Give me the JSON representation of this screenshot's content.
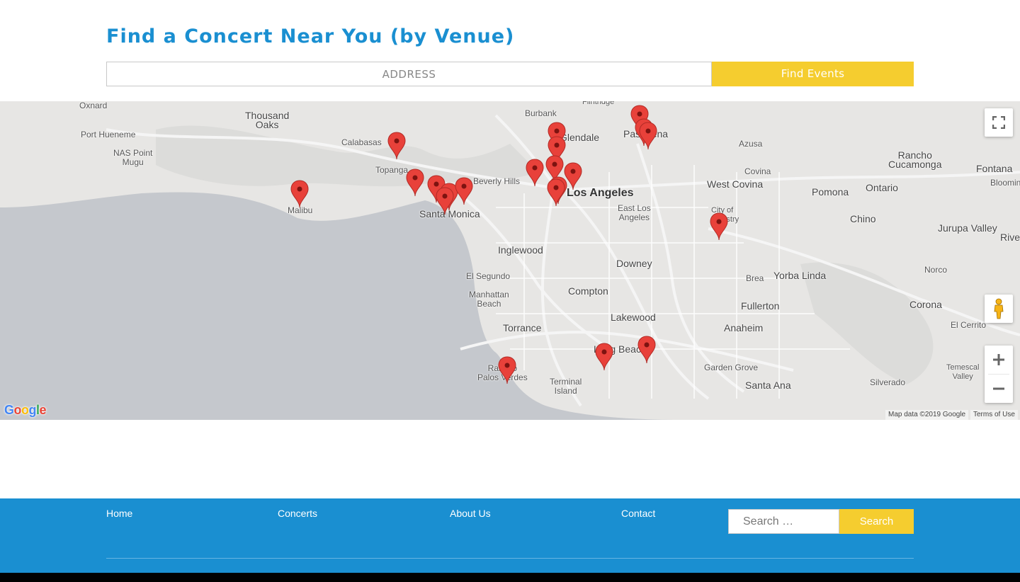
{
  "header": {
    "title": "Find a Concert Near You (by Venue)",
    "address_placeholder": "ADDRESS",
    "find_label": "Find Events"
  },
  "map": {
    "labels": {
      "oxnard": "Oxnard",
      "thousand_oaks": "Thousand\nOaks",
      "port_hueneme": "Port Hueneme",
      "nas_point_mugu": "NAS Point\nMugu",
      "calabasas": "Calabasas",
      "topanga": "Topanga",
      "malibu": "Malibu",
      "santa_monica": "Santa Monica",
      "beverly_hills": "Beverly Hills",
      "burbank": "Burbank",
      "glendale": "Glendale",
      "flintridge": "Flintridge",
      "pasadena": "Pasadena",
      "los_angeles": "Los Angeles",
      "east_los_angeles": "East Los\nAngeles",
      "inglewood": "Inglewood",
      "el_segundo": "El Segundo",
      "manhattan_beach": "Manhattan\nBeach",
      "torrance": "Torrance",
      "rancho_palos_verdes": "Rancho\nPalos Verdes",
      "compton": "Compton",
      "downey": "Downey",
      "lakewood": "Lakewood",
      "long_beach": "Long Beach",
      "terminal_island": "Terminal\nIsland",
      "azusa": "Azusa",
      "covina": "Covina",
      "west_covina": "West Covina",
      "city_of_industry": "City of\nIndustry",
      "pomona": "Pomona",
      "ontario": "Ontario",
      "rancho_cucamonga": "Rancho\nCucamonga",
      "fontana": "Fontana",
      "bloomington": "Bloomin",
      "chino": "Chino",
      "jurupa_valley": "Jurupa Valley",
      "riverside": "Rive",
      "norco": "Norco",
      "brea": "Brea",
      "yorba_linda": "Yorba Linda",
      "fullerton": "Fullerton",
      "anaheim": "Anaheim",
      "corona": "Corona",
      "el_cerrito": "El Cerrito",
      "garden_grove": "Garden Grove",
      "santa_ana": "Santa Ana",
      "silverado": "Silverado",
      "temescal_valley": "Temescal\nValley"
    },
    "google_logo": "Google",
    "map_data_text": "Map data ©2019 Google",
    "terms_text": "Terms of Use",
    "marker_color": "#e8413a"
  },
  "footer": {
    "nav": {
      "home": "Home",
      "concerts": "Concerts",
      "about": "About Us",
      "contact": "Contact"
    },
    "search_placeholder": "Search …",
    "search_label": "Search"
  }
}
